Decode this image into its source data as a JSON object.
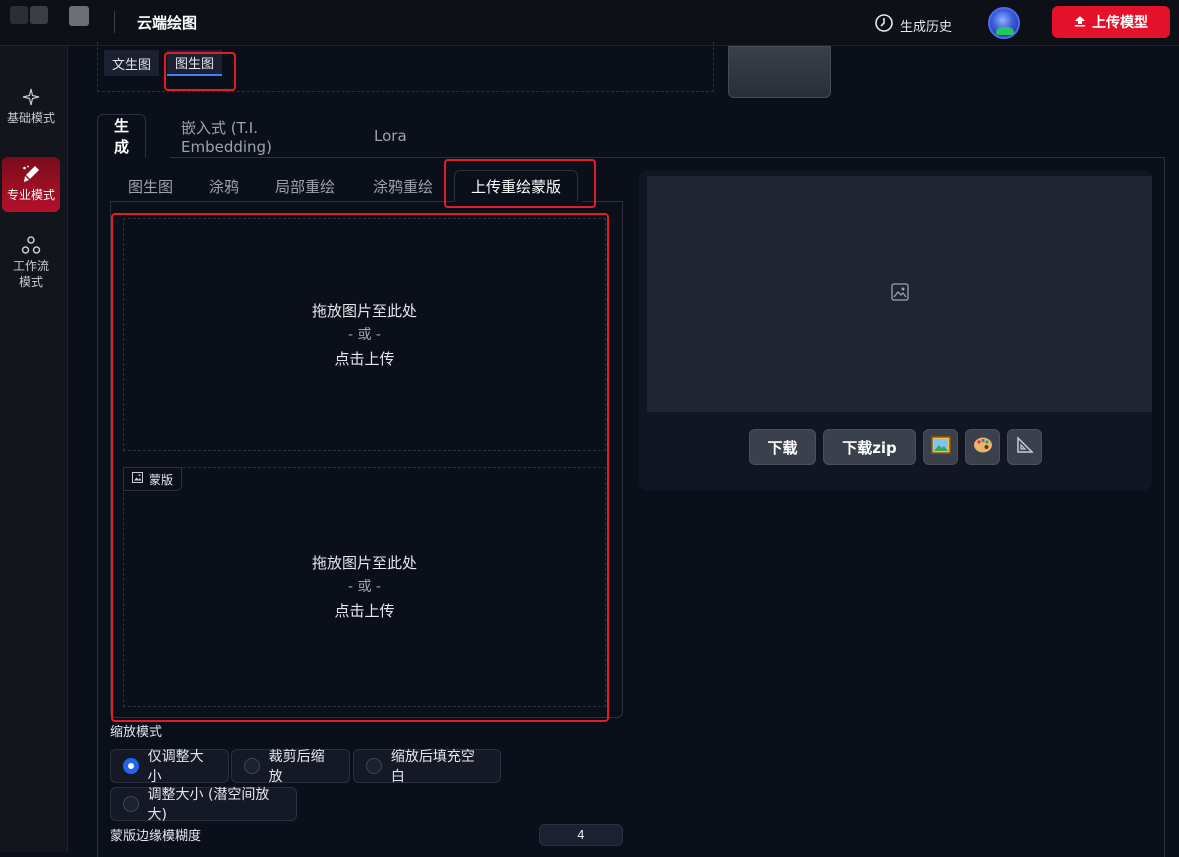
{
  "topbar": {
    "title": "云端绘图",
    "history_label": "生成历史",
    "upload_label": "上传模型"
  },
  "sidebar": {
    "items": [
      {
        "label": "基础模式"
      },
      {
        "label": "专业模式"
      },
      {
        "label_line1": "工作流",
        "label_line2": "模式"
      }
    ]
  },
  "mode_tabs": [
    "文生图",
    "图生图"
  ],
  "main_tabs": [
    "生成",
    "嵌入式 (T.I. Embedding)",
    "Lora"
  ],
  "sub_tabs": [
    "图生图",
    "涂鸦",
    "局部重绘",
    "涂鸦重绘",
    "上传重绘蒙版"
  ],
  "dropzone": {
    "line1": "拖放图片至此处",
    "or": "- 或 -",
    "line2": "点击上传"
  },
  "mask_label": "蒙版",
  "resize": {
    "label": "缩放模式",
    "options": [
      "仅调整大小",
      "裁剪后缩放",
      "缩放后填充空白",
      "调整大小 (潜空间放大)"
    ],
    "selected": "仅调整大小"
  },
  "mask_blur": {
    "label": "蒙版边缘模糊度",
    "value": "4"
  },
  "gallery": {
    "download_label": "下载",
    "download_zip_label": "下载zip"
  }
}
